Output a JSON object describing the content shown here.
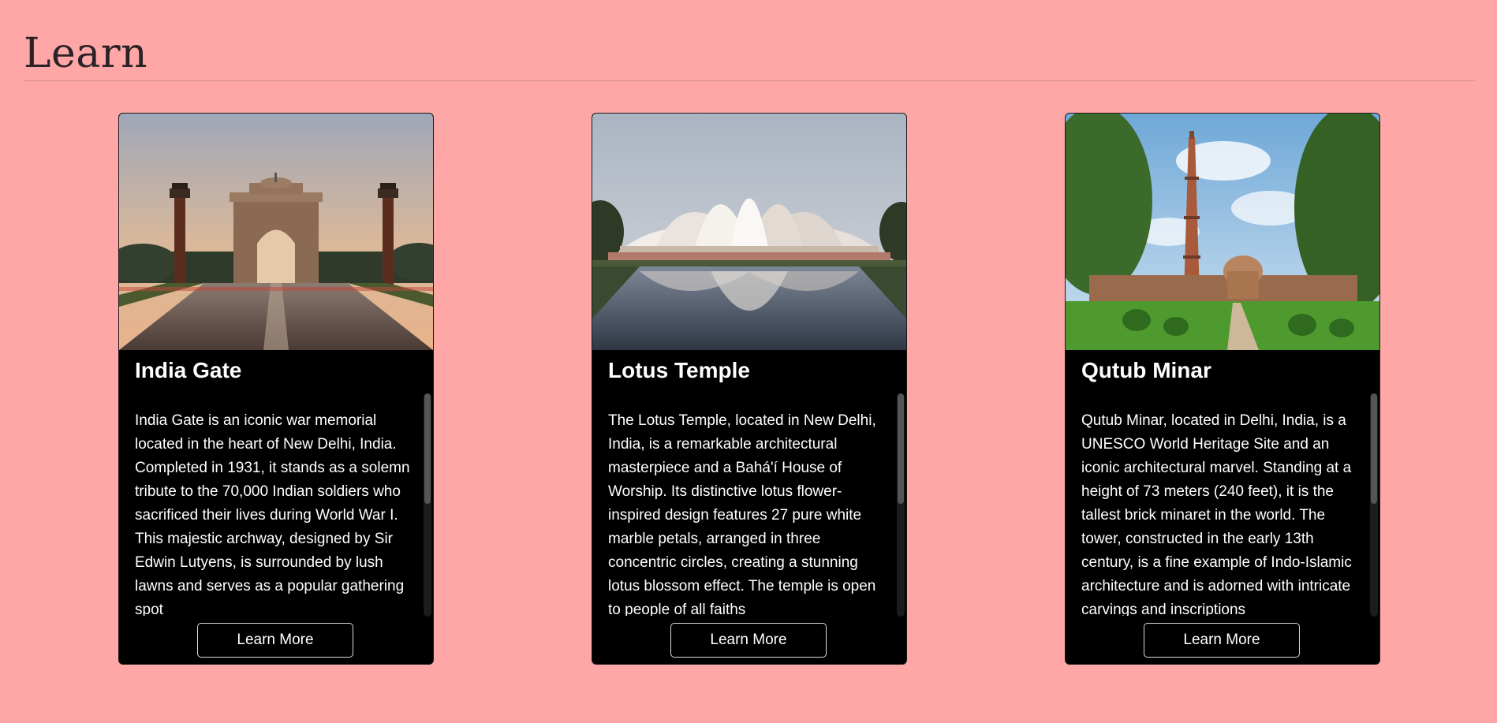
{
  "page": {
    "title": "Learn"
  },
  "cards": [
    {
      "title": "India Gate",
      "text": "India Gate is an iconic war memorial located in the heart of New Delhi, India. Completed in 1931, it stands as a solemn tribute to the 70,000 Indian soldiers who sacrificed their lives during World War I. This majestic archway, designed by Sir Edwin Lutyens, is surrounded by lush lawns and serves as a popular gathering spot",
      "button_label": "Learn More",
      "image_alt": "India Gate"
    },
    {
      "title": "Lotus Temple",
      "text": "The Lotus Temple, located in New Delhi, India, is a remarkable architectural masterpiece and a Bahá'í House of Worship. Its distinctive lotus flower-inspired design features 27 pure white marble petals, arranged in three concentric circles, creating a stunning lotus blossom effect. The temple is open to people of all faiths",
      "button_label": "Learn More",
      "image_alt": "Lotus Temple"
    },
    {
      "title": "Qutub Minar",
      "text": "Qutub Minar, located in Delhi, India, is a UNESCO World Heritage Site and an iconic architectural marvel. Standing at a height of 73 meters (240 feet), it is the tallest brick minaret in the world. The tower, constructed in the early 13th century, is a fine example of Indo-Islamic architecture and is adorned with intricate carvings and inscriptions",
      "button_label": "Learn More",
      "image_alt": "Qutub Minar"
    }
  ],
  "colors": {
    "background": "#ffa7a6",
    "card": "#000000",
    "text": "#ffffff",
    "heading": "#2a2226"
  }
}
